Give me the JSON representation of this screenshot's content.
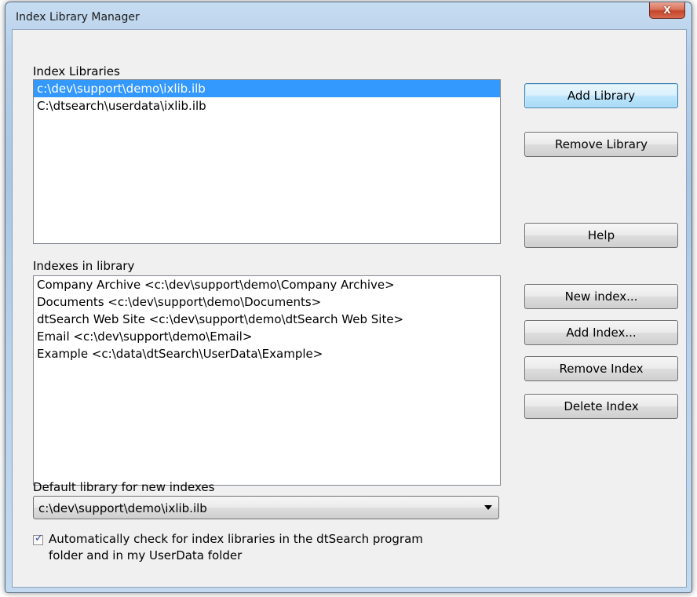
{
  "window": {
    "title": "Index Library Manager",
    "close_glyph": "X"
  },
  "libraries": {
    "label": "Index Libraries",
    "items": [
      {
        "path": "c:\\dev\\support\\demo\\ixlib.ilb",
        "selected": true
      },
      {
        "path": "C:\\dtsearch\\userdata\\ixlib.ilb",
        "selected": false
      }
    ]
  },
  "indexes": {
    "label": "Indexes in library",
    "items": [
      "Company Archive <c:\\dev\\support\\demo\\Company Archive>",
      "Documents <c:\\dev\\support\\demo\\Documents>",
      "dtSearch Web Site <c:\\dev\\support\\demo\\dtSearch Web Site>",
      "Email <c:\\dev\\support\\demo\\Email>",
      "Example <c:\\data\\dtSearch\\UserData\\Example>"
    ]
  },
  "buttons": {
    "add_library": "Add Library",
    "remove_library": "Remove Library",
    "help": "Help",
    "new_index": "New index...",
    "add_index": "Add Index...",
    "remove_index": "Remove Index",
    "delete_index": "Delete Index"
  },
  "default_library": {
    "label": "Default library for new indexes",
    "value": "c:\\dev\\support\\demo\\ixlib.ilb"
  },
  "auto_check": {
    "checked": true,
    "line1": "Automatically check for index libraries in the dtSearch program",
    "line2": "folder and in my UserData folder"
  },
  "colors": {
    "selection": "#3399ff",
    "default_button_border": "#3c7fb1"
  }
}
